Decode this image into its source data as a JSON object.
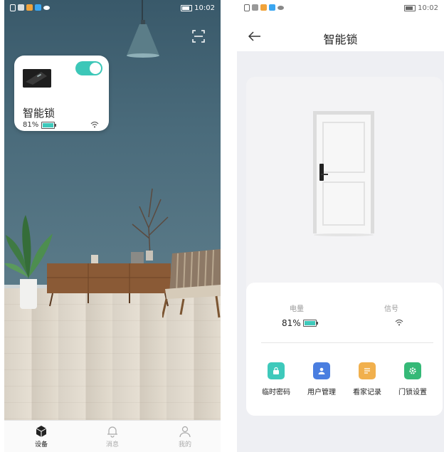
{
  "status_bar": {
    "time": "10:02"
  },
  "home": {
    "device_card": {
      "name": "智能锁",
      "battery_level": "81%",
      "toggle_on": true
    },
    "tabs": [
      {
        "label": "设备",
        "icon": "cube-icon",
        "active": true
      },
      {
        "label": "消息",
        "icon": "bell-icon",
        "active": false
      },
      {
        "label": "我的",
        "icon": "person-icon",
        "active": false
      }
    ]
  },
  "detail": {
    "title": "智能锁",
    "battery_label": "电量",
    "battery_value": "81%",
    "signal_label": "信号",
    "actions": [
      {
        "label": "临时密码",
        "icon": "lock-icon",
        "color": "#3ec9bb"
      },
      {
        "label": "用户管理",
        "icon": "user-icon",
        "color": "#4a7ee0"
      },
      {
        "label": "看家记录",
        "icon": "document-icon",
        "color": "#f1b04d"
      },
      {
        "label": "门锁设置",
        "icon": "gear-icon",
        "color": "#35b977"
      }
    ]
  },
  "colors": {
    "accent": "#3ec9bb",
    "wall": "#4a6b7b"
  }
}
